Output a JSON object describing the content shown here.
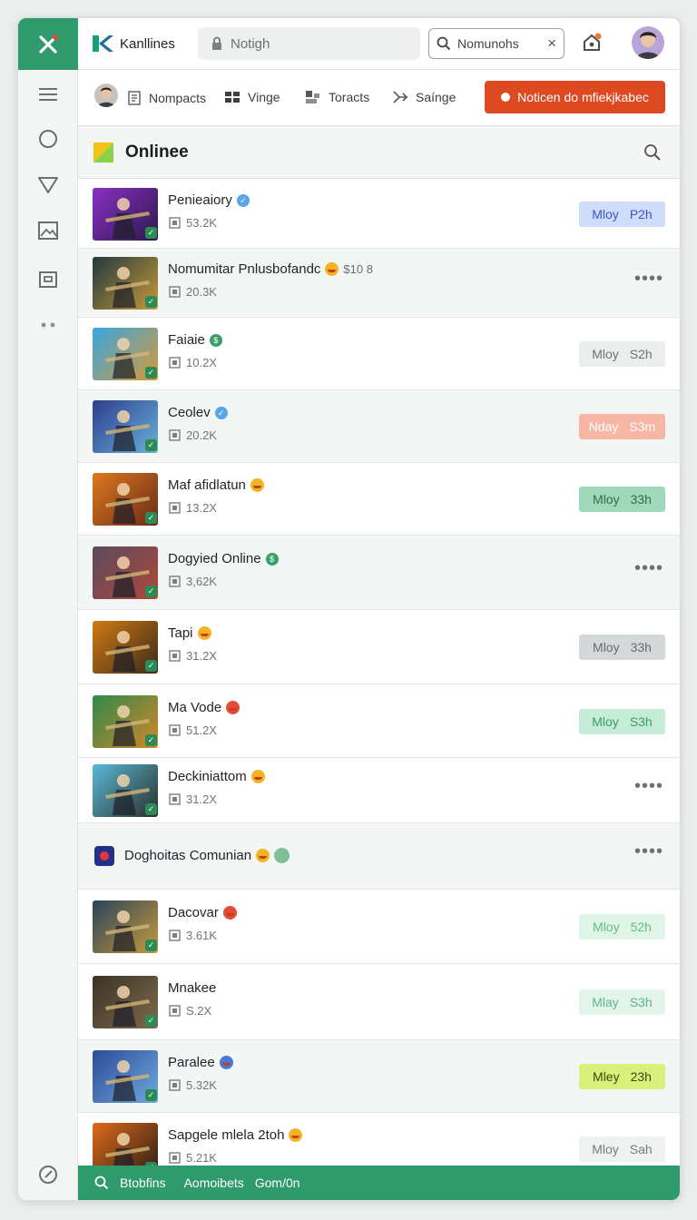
{
  "app": {
    "brand_name": "Kanllines",
    "lock_field_text": "Notigh",
    "search_value": "Nomunohs"
  },
  "navbar": {
    "items": [
      {
        "label": "Nompacts"
      },
      {
        "label": "Vinge"
      },
      {
        "label": "Toracts"
      },
      {
        "label": "Saínge"
      }
    ],
    "cta_label": "Noticen do mfiekjkabec"
  },
  "section": {
    "title": "Onlinee"
  },
  "rows": [
    {
      "name": "Penieaiory",
      "meta": "53.2K",
      "pill": [
        "Mloy",
        "P2h"
      ],
      "pill_color": "#cfdcfb",
      "pill_text": "#3b56c7",
      "action": "pill",
      "alt": false,
      "badge": "verify-blue"
    },
    {
      "name": "Nomumitar Pnlusbofandc",
      "extra": "$10 8",
      "meta": "20.3K",
      "action": "dots",
      "alt": true,
      "badge": "emoji"
    },
    {
      "name": "Faiaie",
      "meta": "10.2X",
      "pill": [
        "Mloy",
        "S2h"
      ],
      "pill_color": "#eceeee",
      "pill_text": "#6e7377",
      "action": "pill",
      "alt": false,
      "badge": "verify-green"
    },
    {
      "name": "Ceolev",
      "meta": "20.2K",
      "pill": [
        "Nday",
        "S3m"
      ],
      "pill_color": "#f8b6a4",
      "pill_text": "#ffffff",
      "action": "pill",
      "alt": true,
      "badge": "verify-blue"
    },
    {
      "name": "Maf afidlatun",
      "meta": "13.2X",
      "pill": [
        "Mloy",
        "33h"
      ],
      "pill_color": "#9fd9b9",
      "pill_text": "#2f6d4c",
      "action": "pill",
      "alt": false,
      "badge": "emoji"
    },
    {
      "name": "Dogyied Online",
      "meta": "3,62K",
      "action": "dots",
      "alt": true,
      "badge": "verify-green"
    },
    {
      "name": "Tapi",
      "meta": "31.2X",
      "pill": [
        "Mloy",
        "33h"
      ],
      "pill_color": "#d5d8d9",
      "pill_text": "#676b6f",
      "action": "pill",
      "alt": false,
      "badge": "emoji"
    },
    {
      "name": "Ma Vode",
      "meta": "51.2X",
      "pill": [
        "Mloy",
        "S3h"
      ],
      "pill_color": "#c5ecd7",
      "pill_text": "#3f9a6c",
      "action": "pill",
      "alt": false,
      "badge": "emoji-red"
    },
    {
      "name": "Deckiniattom",
      "meta": "31.2X",
      "action": "dots",
      "alt": false,
      "badge": "emoji"
    },
    {
      "name": "Dacovar",
      "meta": "3.61K",
      "pill": [
        "Mloy",
        "52h"
      ],
      "pill_color": "#dff5e8",
      "pill_text": "#64b98e",
      "action": "pill",
      "alt": false,
      "badge": "emoji-red"
    },
    {
      "name": "Mnakee",
      "meta": "S.2X",
      "pill": [
        "Mlay",
        "S3h"
      ],
      "pill_color": "#e3f5ea",
      "pill_text": "#5fb389",
      "action": "pill",
      "alt": false,
      "badge": ""
    },
    {
      "name": "Paralee",
      "meta": "5.32K",
      "pill": [
        "Mley",
        "23h"
      ],
      "pill_color": "#d9f07a",
      "pill_text": "#3a4a10",
      "action": "pill",
      "alt": true,
      "badge": "emoji-blue"
    },
    {
      "name": "Sapgele mlela 2toh",
      "meta": "5.21K",
      "pill": [
        "Mloy",
        "Sah"
      ],
      "pill_color": "#f0f1f1",
      "pill_text": "#767a7e",
      "action": "pill",
      "alt": false,
      "badge": "emoji"
    }
  ],
  "group": {
    "title": "Doghoitas Comunian"
  },
  "footer": {
    "items": [
      "Btobfins",
      "Aomoibets",
      "Gom/0n"
    ]
  }
}
